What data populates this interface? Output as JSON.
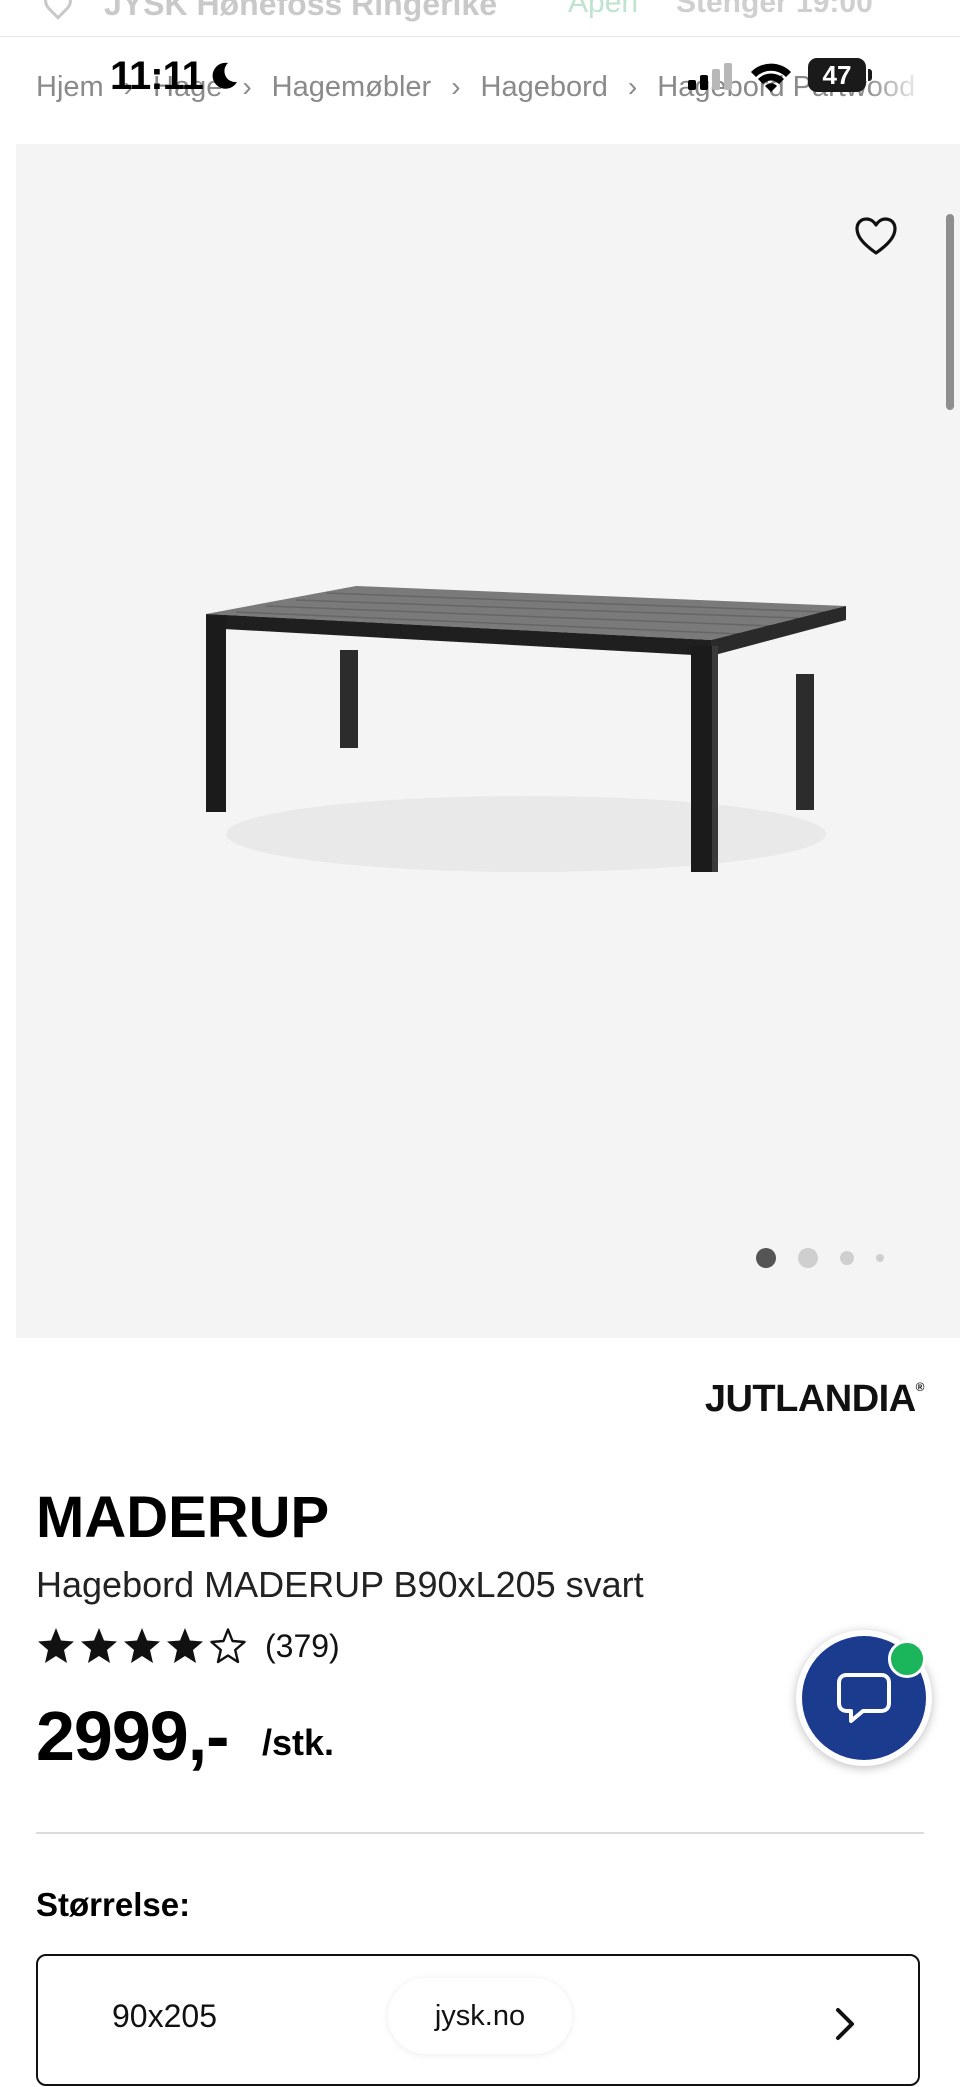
{
  "status_bar": {
    "time": "11:11",
    "battery": "47"
  },
  "store_bar": {
    "name": "JYSK Hønefoss Ringerike",
    "status_open": "Åpen",
    "status_closes": "Stenger 19:00"
  },
  "breadcrumb": {
    "items": [
      "Hjem",
      "Hage",
      "Hagemøbler",
      "Hagebord",
      "Hagebord Partwood"
    ]
  },
  "gallery": {
    "image_alt": "Hagebord MADERUP svart",
    "dot_count": 4,
    "active_dot": 0
  },
  "product": {
    "brand": "JUTLANDIA",
    "title": "MADERUP",
    "subtitle": "Hagebord MADERUP B90xL205 svart",
    "rating_value": 4,
    "rating_max": 5,
    "rating_count": "(379)",
    "price": "2999,-",
    "price_unit": "/stk."
  },
  "size": {
    "label": "Størrelse:",
    "selected": "90x205"
  },
  "browser": {
    "url": "jysk.no"
  },
  "colors": {
    "chat_button": "#1b3b8f",
    "online_indicator": "#1bb55c",
    "gallery_bg": "#f4f4f4"
  }
}
